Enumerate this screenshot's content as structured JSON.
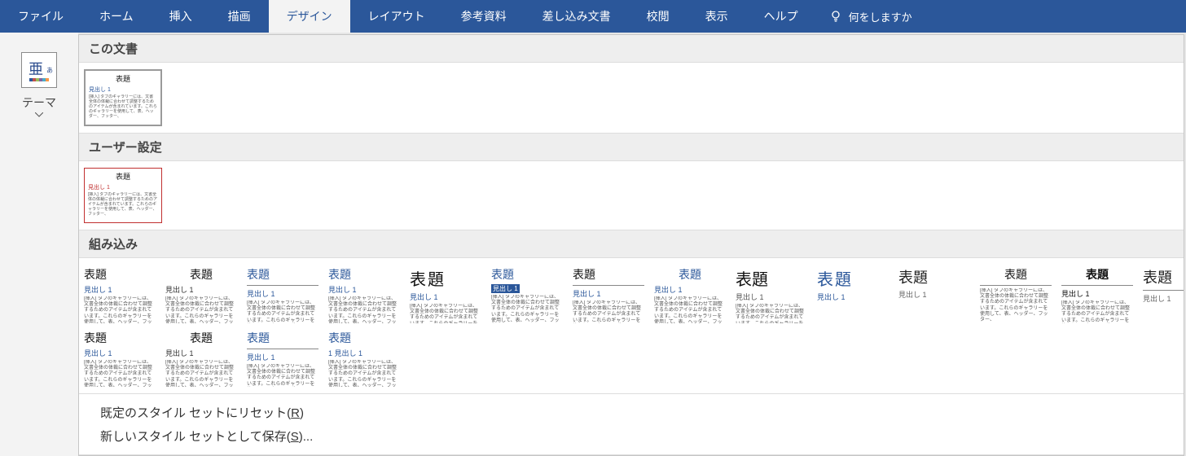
{
  "ribbon": {
    "tabs": [
      {
        "label": "ファイル"
      },
      {
        "label": "ホーム"
      },
      {
        "label": "挿入"
      },
      {
        "label": "描画"
      },
      {
        "label": "デザイン"
      },
      {
        "label": "レイアウト"
      },
      {
        "label": "参考資料"
      },
      {
        "label": "差し込み文書"
      },
      {
        "label": "校閲"
      },
      {
        "label": "表示"
      },
      {
        "label": "ヘルプ"
      }
    ],
    "active_index": 4,
    "tell_me": "何をしますか"
  },
  "themes_button": {
    "label": "テーマ",
    "dropdown_label": "▾"
  },
  "sections": {
    "this_doc": "この文書",
    "user": "ユーザー設定",
    "builtin": "組み込み"
  },
  "thumb_text": {
    "title": "表題",
    "h1": "見出し 1",
    "h1_num": "1 見出し 1",
    "body": "[挿入] タブのギャラリーには、文書全体の体裁に合わせて調整するためのアイテムが含まれています。これらのギャラリーを使用して、表、ヘッダー、フッター、"
  },
  "menu": {
    "reset": {
      "pre": "既定のスタイル セットにリセット(",
      "key": "R",
      "post": ")"
    },
    "save": {
      "pre": "新しいスタイル セットとして保存(",
      "key": "S",
      "post": ")..."
    }
  },
  "colors": {
    "ribbon_bg": "#2b579a",
    "accent_red": "#c12f2f"
  }
}
